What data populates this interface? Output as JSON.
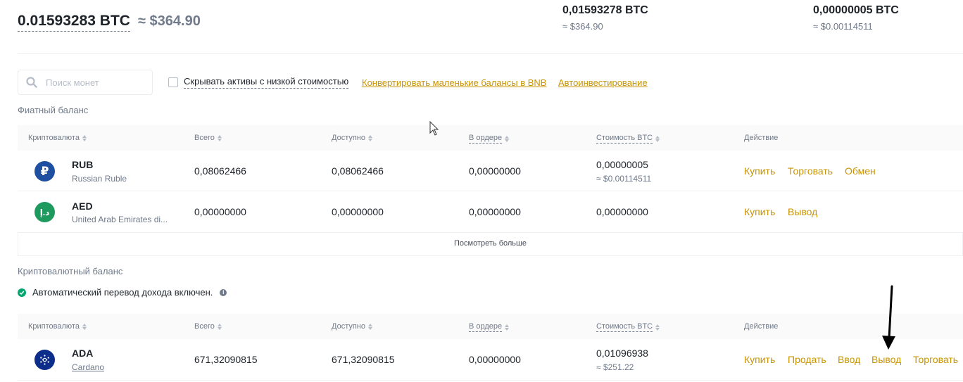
{
  "summary": {
    "total_btc": "0.01593283 BTC",
    "total_usd": "≈ $364.90",
    "col1_btc": "0,01593278 BTC",
    "col1_usd": "≈ $364.90",
    "col2_btc": "0,00000005 BTC",
    "col2_usd": "≈ $0.00114511"
  },
  "filters": {
    "search_placeholder": "Поиск монет",
    "hide_small_label": "Скрывать активы с низкой стоимостью",
    "convert_link": "Конвертировать маленькие балансы в BNB",
    "autoinvest_link": "Автоинвестирование"
  },
  "fiat": {
    "title": "Фиатный баланс",
    "headers": {
      "currency": "Криптовалюта",
      "total": "Всего",
      "available": "Доступно",
      "in_order": "В ордере",
      "btc_value": "Стоимость BTC",
      "action": "Действие"
    },
    "rows": [
      {
        "symbol": "RUB",
        "name": "Russian Ruble",
        "icon": "ruble-icon",
        "icon_color": "#1e4fa0",
        "total": "0,08062466",
        "available": "0,08062466",
        "in_order": "0,00000000",
        "btc": "0,00000005",
        "usd": "≈ $0.00114511",
        "actions": [
          "Купить",
          "Торговать",
          "Обмен"
        ]
      },
      {
        "symbol": "AED",
        "name": "United Arab Emirates di...",
        "icon": "dirham-icon",
        "icon_color": "#1f9a5e",
        "total": "0,00000000",
        "available": "0,00000000",
        "in_order": "0,00000000",
        "btc": "0,00000000",
        "actions": [
          "Купить",
          "Вывод"
        ]
      }
    ],
    "see_more": "Посмотреть больше"
  },
  "crypto": {
    "title": "Криптовалютный баланс",
    "auto_transfer": "Автоматический перевод дохода включен.",
    "headers": {
      "currency": "Криптовалюта",
      "total": "Всего",
      "available": "Доступно",
      "in_order": "В ордере",
      "btc_value": "Стоимость BTC",
      "action": "Действие"
    },
    "rows": [
      {
        "symbol": "ADA",
        "name": "Cardano",
        "icon": "cardano-icon",
        "icon_color": "#0d2d8a",
        "total": "671,32090815",
        "available": "671,32090815",
        "in_order": "0,00000000",
        "btc": "0,01096938",
        "usd": "≈ $251.22",
        "actions": [
          "Купить",
          "Продать",
          "Ввод",
          "Вывод",
          "Торговать"
        ]
      }
    ]
  },
  "colors": {
    "accent": "#c99400",
    "text": "#1e2329",
    "muted": "#707a8a",
    "success": "#03a66d"
  }
}
